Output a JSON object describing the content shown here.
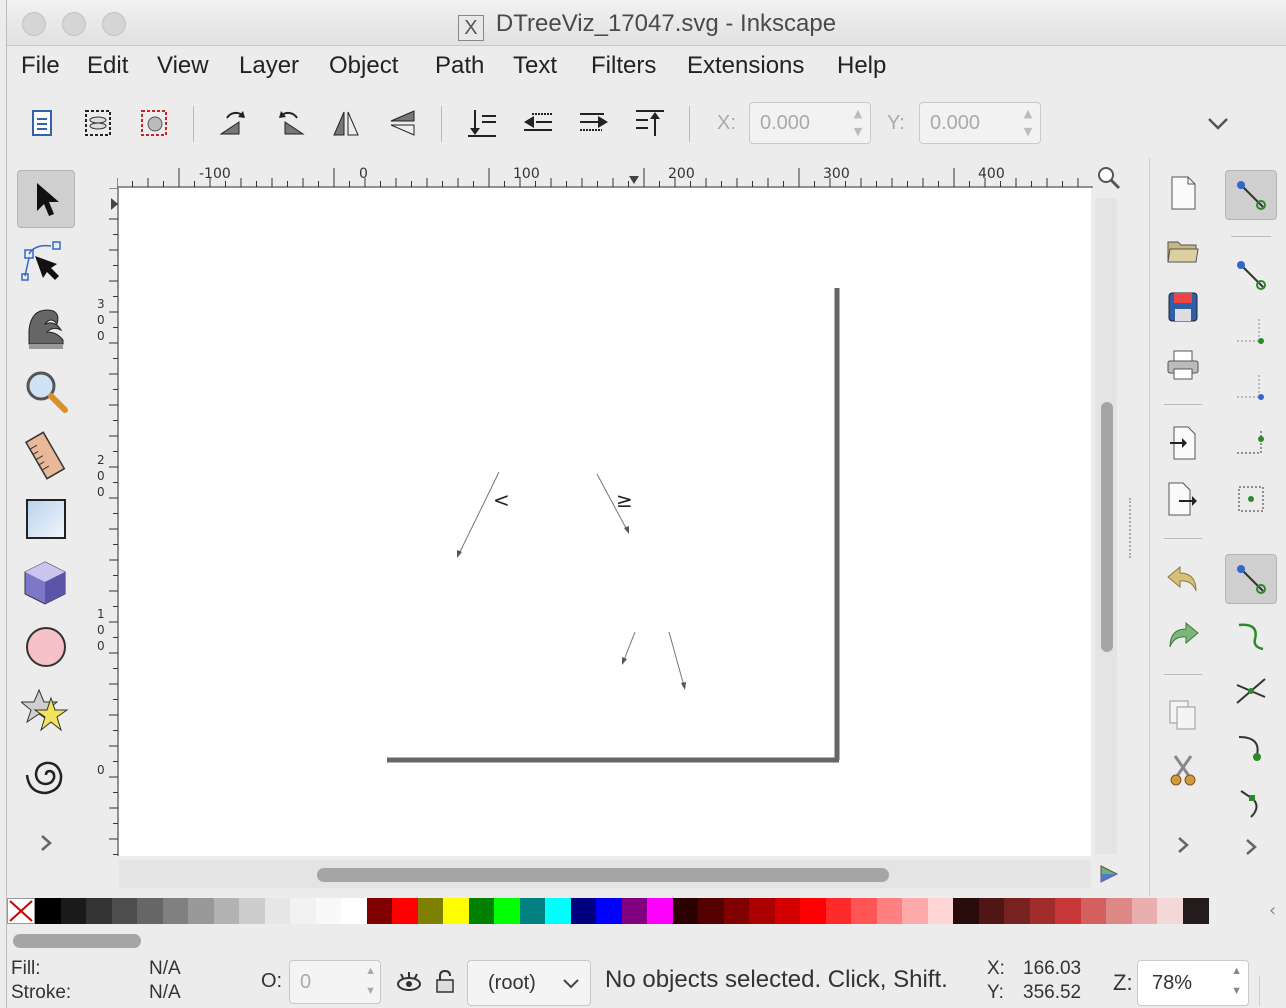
{
  "window": {
    "title": "DTreeViz_17047.svg - Inkscape"
  },
  "menu": [
    "File",
    "Edit",
    "View",
    "Layer",
    "Object",
    "Path",
    "Text",
    "Filters",
    "Extensions",
    "Help"
  ],
  "toolbar": {
    "x_label": "X:",
    "x_value": "0.000",
    "y_label": "Y:",
    "y_value": "0.000"
  },
  "ruler": {
    "h_ticks": [
      "-100",
      "0",
      "100",
      "200",
      "300",
      "400"
    ],
    "v_ticks": [
      "300",
      "200",
      "100",
      "0"
    ]
  },
  "canvas": {
    "less_than": "<",
    "greater_equal": "≥"
  },
  "palette_colors": [
    "#000000",
    "#1a1a1a",
    "#333333",
    "#4d4d4d",
    "#666666",
    "#808080",
    "#999999",
    "#b3b3b3",
    "#cccccc",
    "#e6e6e6",
    "#f2f2f2",
    "#f9f9f9",
    "#ffffff",
    "#800000",
    "#ff0000",
    "#808000",
    "#ffff00",
    "#008000",
    "#00ff00",
    "#008080",
    "#00ffff",
    "#000080",
    "#0000ff",
    "#800080",
    "#ff00ff",
    "#2b0000",
    "#550000",
    "#800000",
    "#aa0000",
    "#d40000",
    "#ff0000",
    "#ff2a2a",
    "#ff5555",
    "#ff8080",
    "#ffaaaa",
    "#ffd5d5",
    "#280b0b",
    "#501616",
    "#782121",
    "#a02c2c",
    "#c83737",
    "#d35f5f",
    "#de8787",
    "#e9afaf",
    "#f4d7d7",
    "#241c1c"
  ],
  "status": {
    "fill_label": "Fill:",
    "fill_value": "N/A",
    "stroke_label": "Stroke:",
    "stroke_value": "N/A",
    "opacity_label": "O:",
    "opacity_value": "0",
    "layer": "(root)",
    "message": "No objects selected. Click, Shift.",
    "x_label": "X:",
    "x_value": "166.03",
    "y_label": "Y:",
    "y_value": "356.52",
    "zoom_label": "Z:",
    "zoom_value": "78%"
  }
}
